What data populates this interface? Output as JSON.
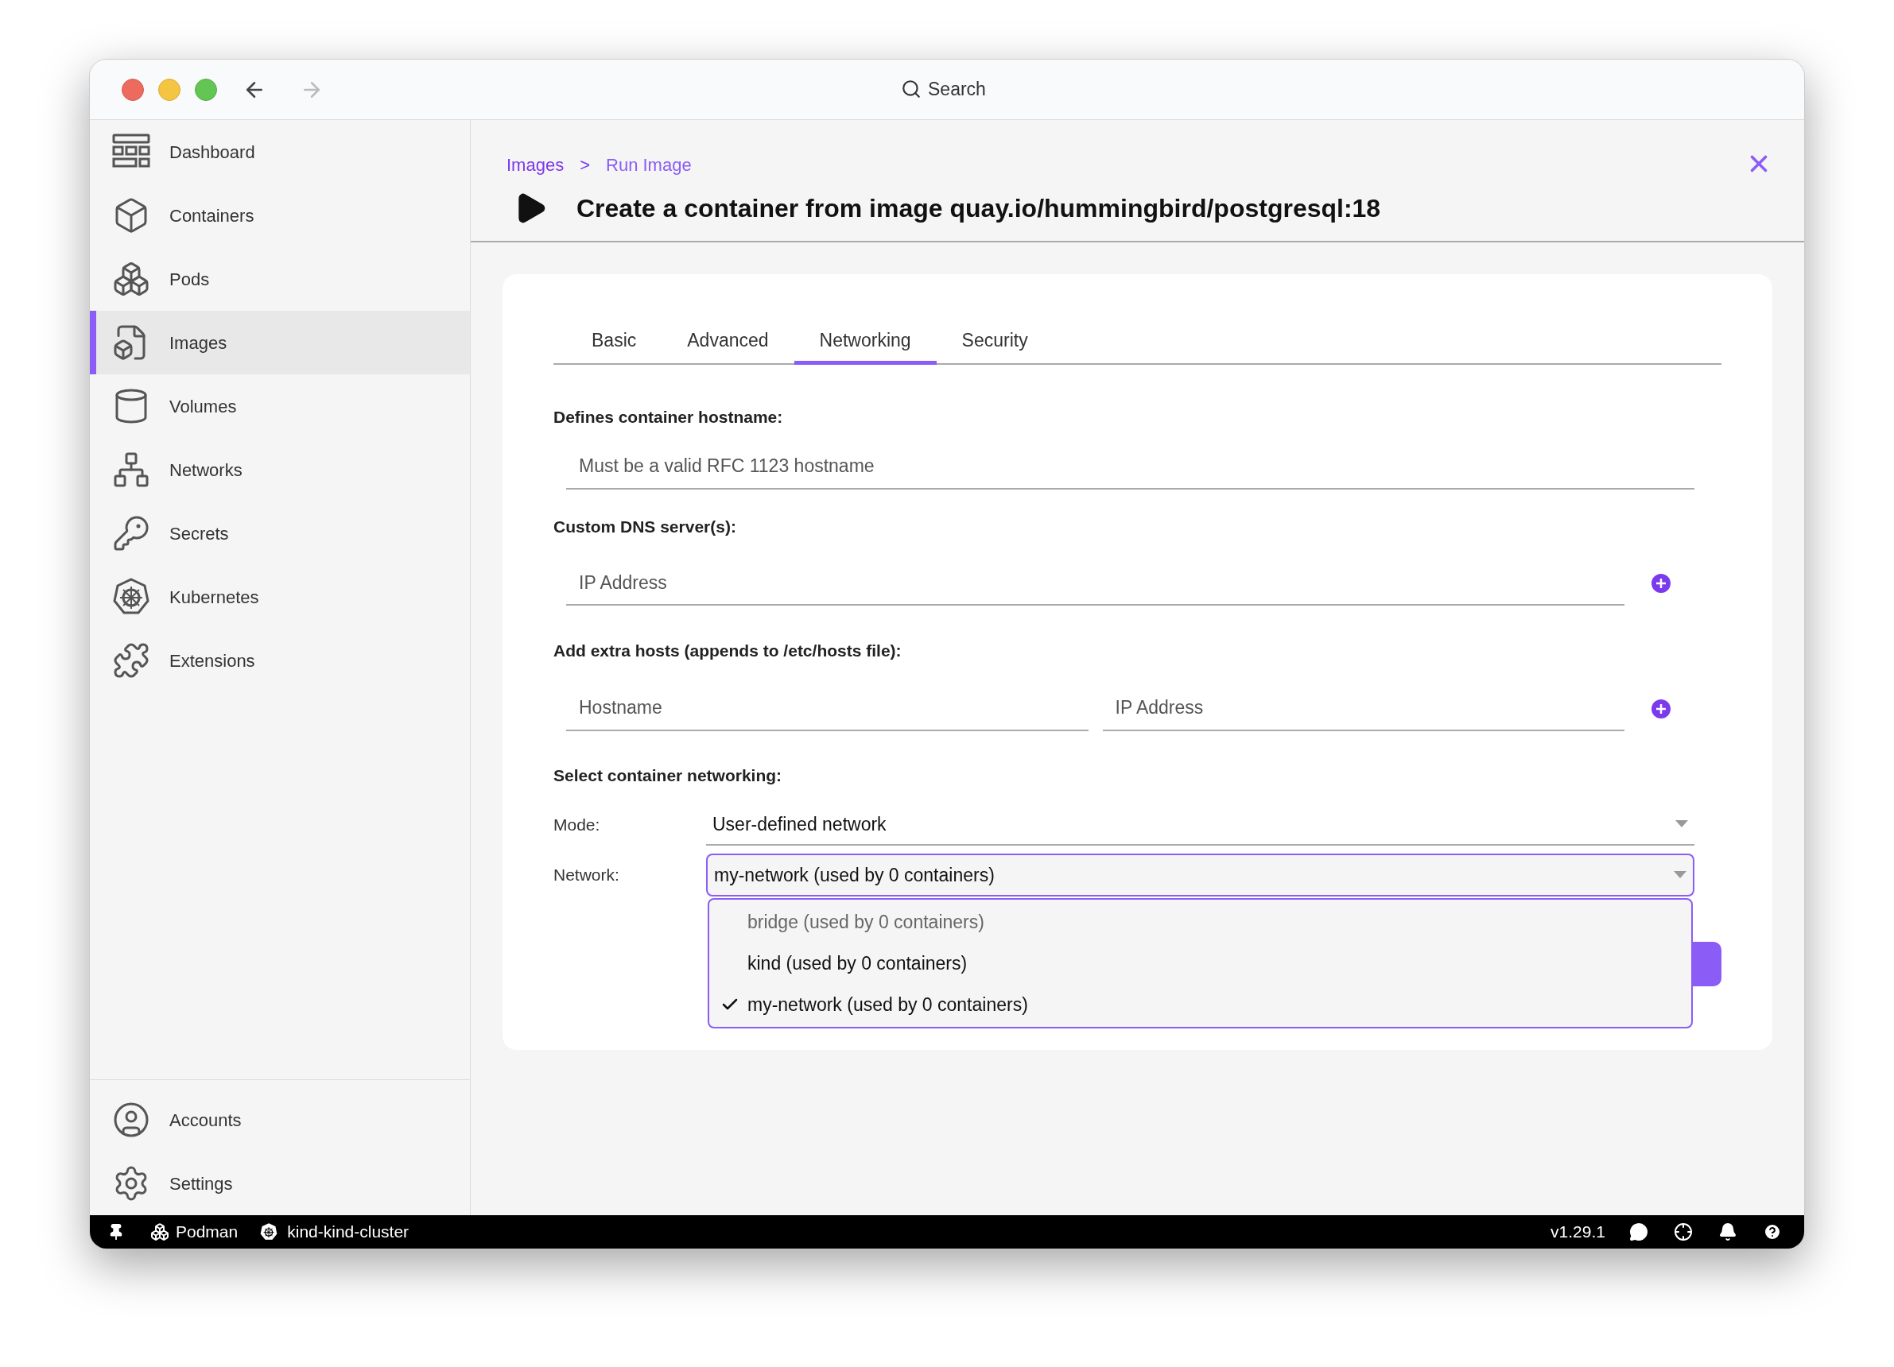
{
  "window": {
    "search": "Search"
  },
  "sidebar": {
    "items": [
      {
        "label": "Dashboard",
        "selected": false
      },
      {
        "label": "Containers",
        "selected": false
      },
      {
        "label": "Pods",
        "selected": false
      },
      {
        "label": "Images",
        "selected": true
      },
      {
        "label": "Volumes",
        "selected": false
      },
      {
        "label": "Networks",
        "selected": false
      },
      {
        "label": "Secrets",
        "selected": false
      },
      {
        "label": "Kubernetes",
        "selected": false
      },
      {
        "label": "Extensions",
        "selected": false
      }
    ],
    "bottom_items": [
      {
        "label": "Accounts"
      },
      {
        "label": "Settings"
      }
    ]
  },
  "breadcrumb": {
    "items": [
      "Images",
      "Run Image"
    ],
    "separator": ">"
  },
  "page_title": "Create a container from image quay.io/hummingbird/postgresql:18",
  "tabs": [
    {
      "label": "Basic",
      "selected": false
    },
    {
      "label": "Advanced",
      "selected": false
    },
    {
      "label": "Networking",
      "selected": true
    },
    {
      "label": "Security",
      "selected": false
    }
  ],
  "form": {
    "hostname": {
      "label": "Defines container hostname:",
      "placeholder": "Must be a valid RFC 1123 hostname"
    },
    "dns": {
      "label": "Custom DNS server(s):",
      "placeholder": "IP Address"
    },
    "extra_hosts": {
      "label": "Add extra hosts (appends to /etc/hosts file):",
      "fields": [
        {
          "placeholder": "Hostname"
        },
        {
          "placeholder": "IP Address"
        }
      ]
    },
    "networking": {
      "label": "Select container networking:",
      "mode": {
        "label": "Mode:",
        "value": "User-defined network"
      },
      "network": {
        "label": "Network:",
        "value": "my-network (used by 0 containers)",
        "expanded": true,
        "options": [
          {
            "label": "bridge (used by 0 containers)",
            "selected": false,
            "disabled": true
          },
          {
            "label": "kind (used by 0 containers)",
            "selected": false,
            "disabled": false
          },
          {
            "label": "my-network (used by 0 containers)",
            "selected": true,
            "disabled": false
          }
        ]
      }
    }
  },
  "status_bar": {
    "left": [
      "Podman",
      "kind-kind-cluster"
    ],
    "version": "v1.29.1"
  }
}
